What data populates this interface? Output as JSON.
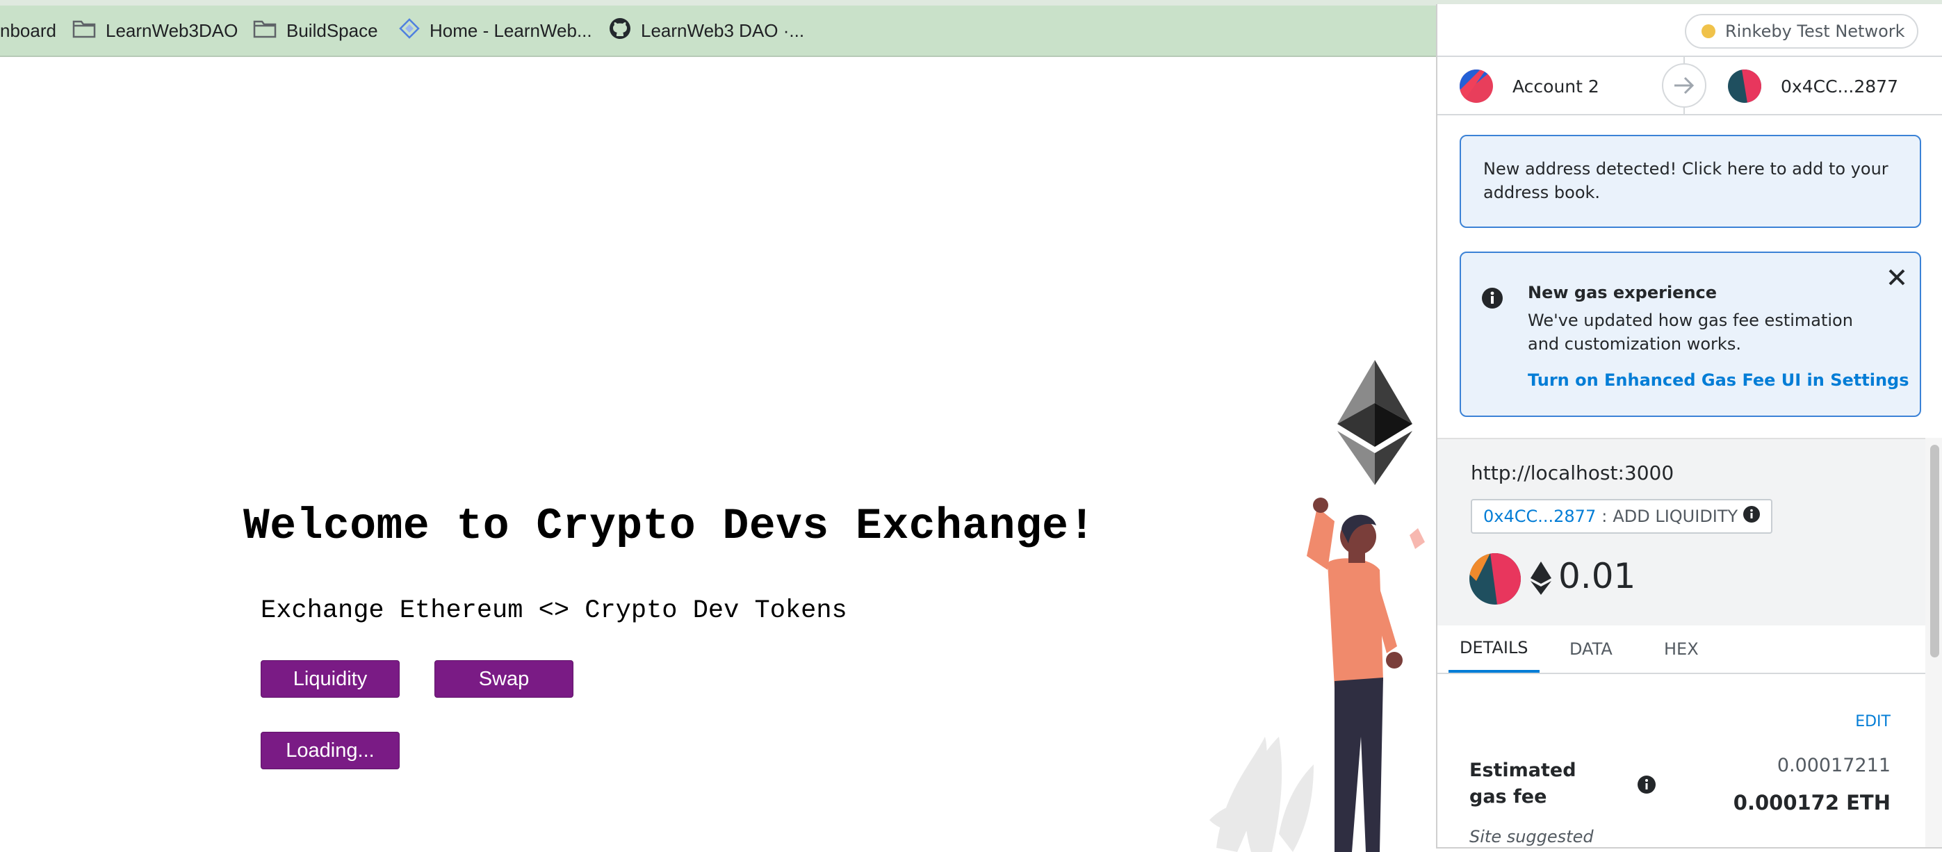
{
  "bookmarks": [
    {
      "label": "nboard",
      "icon": "none"
    },
    {
      "label": "LearnWeb3DAO",
      "icon": "folder-icon"
    },
    {
      "label": "BuildSpace",
      "icon": "folder-icon"
    },
    {
      "label": "Home - LearnWeb...",
      "icon": "diamond-icon"
    },
    {
      "label": "LearnWeb3 DAO ·...",
      "icon": "github-icon"
    }
  ],
  "page": {
    "title": "Welcome to Crypto Devs Exchange!",
    "subtitle": "Exchange Ethereum <> Crypto Dev Tokens",
    "liquidity_button": "Liquidity",
    "swap_button": "Swap",
    "loading_button": "Loading...",
    "button_color": "#7a1b85"
  },
  "metamask": {
    "network": "Rinkeby Test Network",
    "from_account": "Account 2",
    "to_address": "0x4CC...2877",
    "address_notice": "New address detected! Click here to add to your address book.",
    "gas_notice": {
      "title": "New gas experience",
      "body": "We've updated how gas fee estimation and customization works.",
      "link": "Turn on Enhanced Gas Fee UI in Settings"
    },
    "origin": "http://localhost:3000",
    "method_address": "0x4CC...2877",
    "method_separator": ":",
    "method_name": "ADD LIQUIDITY",
    "amount": "0.01",
    "tabs": [
      "DETAILS",
      "DATA",
      "HEX"
    ],
    "active_tab": "DETAILS",
    "edit_label": "EDIT",
    "gas_fee_label": "Estimated gas fee",
    "gas_fee_secondary": "0.00017211",
    "gas_fee_primary": "0.000172 ETH",
    "site_suggested": "Site suggested",
    "accent_color": "#037dd6"
  }
}
